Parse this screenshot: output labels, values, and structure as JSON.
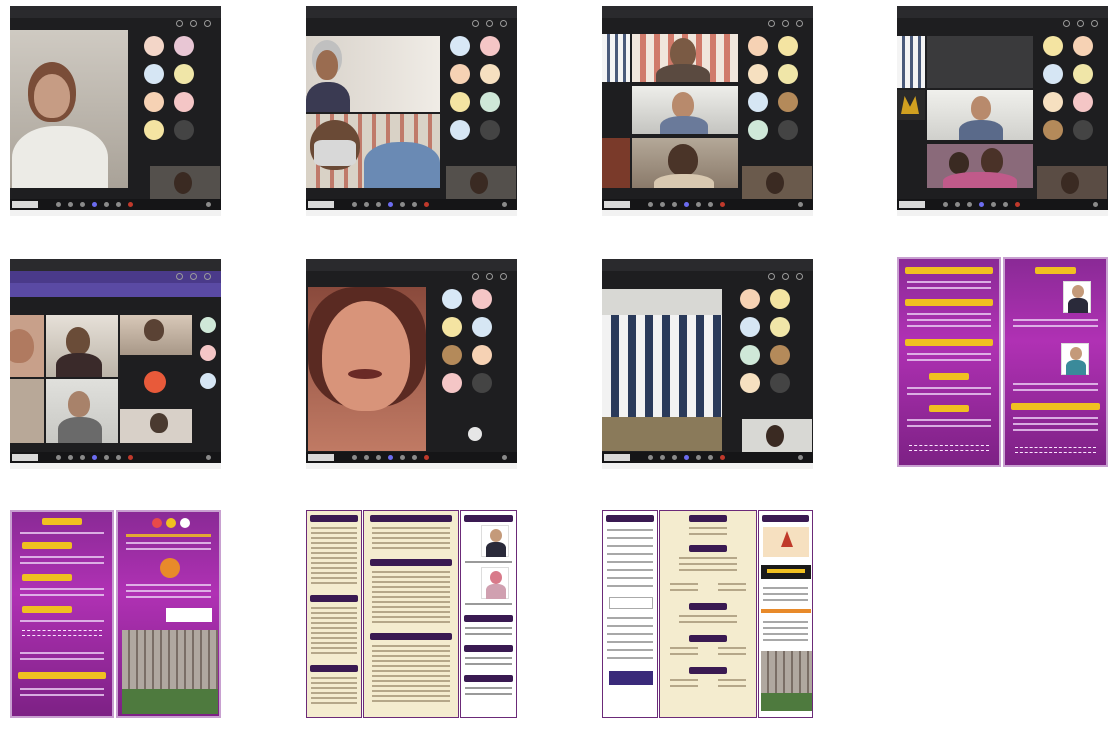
{
  "thumbnails": [
    {
      "kind": "meeting",
      "name": "meeting-screenshot-1"
    },
    {
      "kind": "meeting",
      "name": "meeting-screenshot-2"
    },
    {
      "kind": "meeting",
      "name": "meeting-screenshot-3"
    },
    {
      "kind": "meeting",
      "name": "meeting-screenshot-4"
    },
    {
      "kind": "meeting",
      "name": "meeting-screenshot-5"
    },
    {
      "kind": "meeting",
      "name": "meeting-screenshot-6"
    },
    {
      "kind": "meeting",
      "name": "meeting-screenshot-7"
    },
    {
      "kind": "brochure",
      "name": "brochure-page-1"
    },
    {
      "kind": "brochure",
      "name": "brochure-page-2"
    },
    {
      "kind": "brochure",
      "name": "brochure-page-3"
    },
    {
      "kind": "brochure",
      "name": "brochure-page-4"
    }
  ],
  "colors": {
    "meeting_bg": "#1e1e20",
    "brochure_purple": "#a12fa8",
    "brochure_gold": "#f0c020",
    "brochure_cream": "#f4eccf",
    "end_call": "#c0392b"
  },
  "participant_colors": [
    "#f3d6c8",
    "#e8c6d4",
    "#d6e6f4",
    "#f0e6a8",
    "#f6d2b4",
    "#f4c6c6",
    "#f4e4a2",
    "#d8e8f6",
    "#cfe8d8",
    "#f0d0b0",
    "#f6e0c0",
    "#e0e0e0"
  ],
  "icons": [
    "video-icon",
    "mic-icon",
    "share-icon",
    "chat-icon",
    "participants-icon",
    "raise-hand-icon",
    "more-icon",
    "end-call-icon"
  ]
}
